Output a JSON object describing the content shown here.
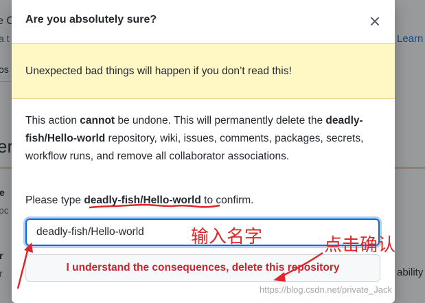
{
  "background": {
    "frag_top": "e C",
    "frag_a": "a t",
    "frag_learn": "Learn",
    "frag_pos": "os",
    "frag_er": "er",
    "frag_e": "e",
    "frag_pc": "pc",
    "frag_r": "r",
    "frag_r2": "r",
    "frag_ability": "ability"
  },
  "modal": {
    "title": "Are you absolutely sure?",
    "flash": "Unexpected bad things will happen if you don’t read this!",
    "body_1": "This action ",
    "body_cannot": "cannot",
    "body_2": " be undone. This will permanently delete the ",
    "body_repo": "deadly-fish/Hello-world",
    "body_3": " repository, wiki, issues, comments, packages, secrets, workflow runs, and remove all collaborator associations.",
    "confirm_prefix": "Please type ",
    "confirm_repo": "deadly-fish/Hello-world",
    "confirm_suffix": " to confirm.",
    "input_value": "deadly-fish/Hello-world",
    "delete_label": "I understand the consequences, delete this repository"
  },
  "annotations": {
    "input_name": "输入名字",
    "click_confirm": "点击确认",
    "annotation_color": "#e0262c"
  },
  "watermark": "https://blog.csdn.net/private_Jack"
}
